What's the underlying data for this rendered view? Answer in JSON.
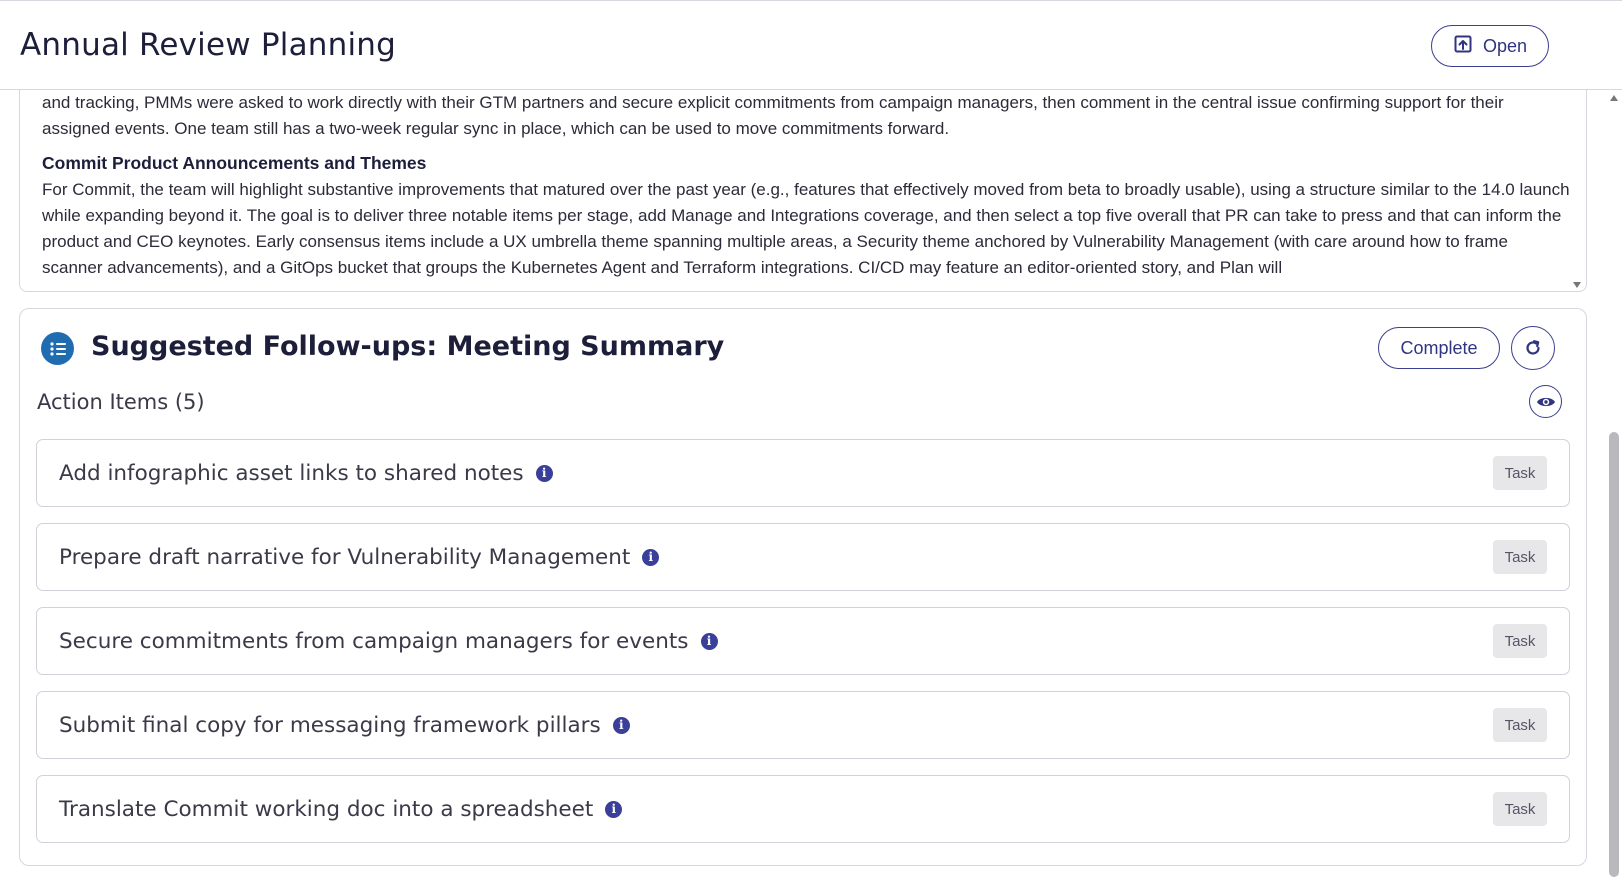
{
  "header": {
    "title": "Annual Review Planning",
    "open_label": "Open"
  },
  "notes": {
    "paragraph_1": "and tracking, PMMs were asked to work directly with their GTM partners and secure explicit commitments from campaign managers, then comment in the central issue confirming support for their assigned events. One team still has a two-week regular sync in place, which can be used to move commitments forward.",
    "heading_2": "Commit Product Announcements and Themes",
    "paragraph_2": "For Commit, the team will highlight substantive improvements that matured over the past year (e.g., features that effectively moved from beta to broadly usable), using a structure similar to the 14.0 launch while expanding beyond it. The goal is to deliver three notable items per stage, add Manage and Integrations coverage, and then select a top five overall that PR can take to press and that can inform the product and CEO keynotes. Early consensus items include a UX umbrella theme spanning multiple areas, a Security theme anchored by Vulnerability Management (with care around how to frame scanner advancements), and a GitOps bucket that groups the Kubernetes Agent and Terraform integrations. CI/CD may feature an editor-oriented story, and Plan will"
  },
  "summary": {
    "title": "Suggested Follow-ups: Meeting Summary",
    "complete_label": "Complete",
    "section_label": "Action Items (5)",
    "items": [
      {
        "label": "Add infographic asset links to shared notes",
        "badge": "Task"
      },
      {
        "label": "Prepare draft narrative for Vulnerability Management",
        "badge": "Task"
      },
      {
        "label": "Secure commitments from campaign managers for events",
        "badge": "Task"
      },
      {
        "label": "Submit final copy for messaging framework pillars",
        "badge": "Task"
      },
      {
        "label": "Translate Commit working doc into a spreadsheet",
        "badge": "Task"
      }
    ]
  },
  "colors": {
    "accent": "#2f3580",
    "summary_icon_bg": "#1f6cb0",
    "info_icon": "#3a3f9a"
  },
  "icons": {
    "open": "open-external-icon",
    "summary": "list-icon",
    "refresh": "refresh-icon",
    "visibility": "eye-icon",
    "info": "info-icon"
  }
}
